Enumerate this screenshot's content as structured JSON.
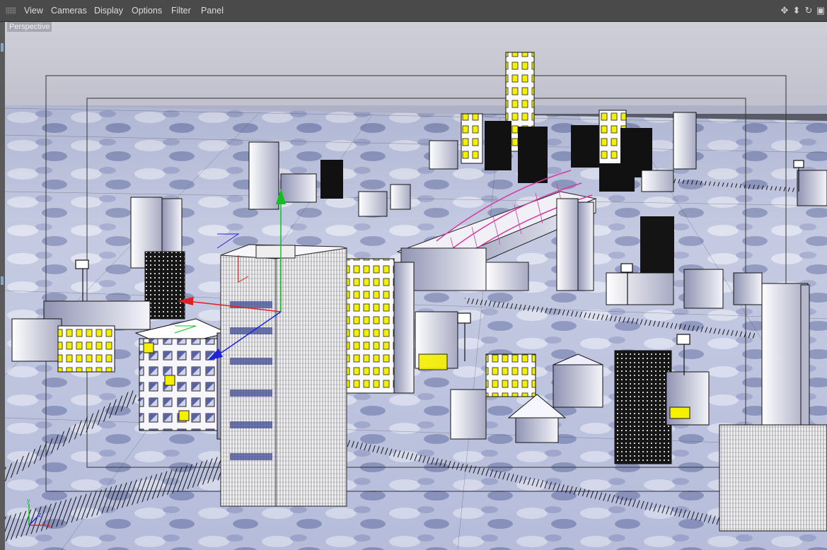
{
  "menubar": {
    "items": [
      "View",
      "Cameras",
      "Display",
      "Options",
      "Filter",
      "Panel"
    ],
    "nav_icons": [
      "move-icon",
      "zoom-icon",
      "rotate-icon",
      "maximize-icon"
    ]
  },
  "viewport": {
    "camera_label": "Perspective"
  },
  "colors": {
    "sky": "#c9c9d3",
    "ground": "#bcc3dc",
    "window_lit": "#f5f000",
    "axis_x": "#e02020",
    "axis_y": "#10c020",
    "axis_z": "#2020e0",
    "arch": "#d43aa0"
  }
}
